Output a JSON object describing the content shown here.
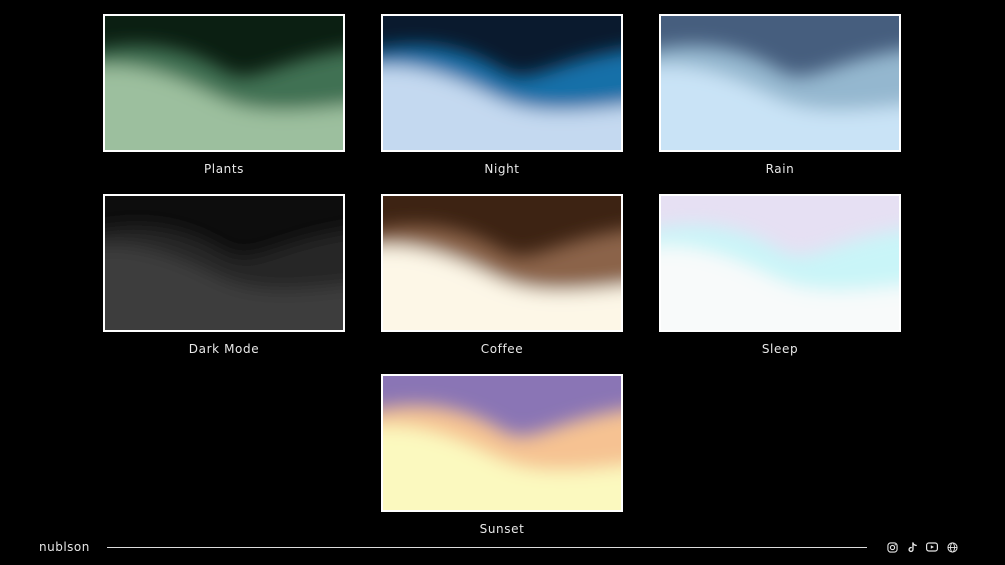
{
  "themes": [
    {
      "label": "Plants",
      "colors": {
        "top": "#0b1f12",
        "mid": "#3f7152",
        "bottom": "#9cbf9e"
      }
    },
    {
      "label": "Night",
      "colors": {
        "top": "#0a1a2e",
        "mid": "#1470a8",
        "bottom": "#c4d9f0"
      }
    },
    {
      "label": "Rain",
      "colors": {
        "top": "#465e7e",
        "mid": "#94b7cf",
        "bottom": "#c9e3f6"
      }
    },
    {
      "label": "Dark Mode",
      "colors": {
        "top": "#0d0d0d",
        "mid": "#262626",
        "bottom": "#3c3c3c"
      }
    },
    {
      "label": "Coffee",
      "colors": {
        "top": "#3d2313",
        "mid": "#8b6448",
        "bottom": "#fdf7e7"
      }
    },
    {
      "label": "Sleep",
      "colors": {
        "top": "#e6e0f3",
        "mid": "#c9f5f8",
        "bottom": "#f8fafa"
      }
    },
    {
      "label": "Sunset",
      "colors": {
        "top": "#8a75b5",
        "mid": "#f6c292",
        "bottom": "#fbf9bf"
      }
    }
  ],
  "footer": {
    "brand": "nublson",
    "socials": [
      "instagram-icon",
      "tiktok-icon",
      "youtube-icon",
      "globe-icon"
    ]
  }
}
